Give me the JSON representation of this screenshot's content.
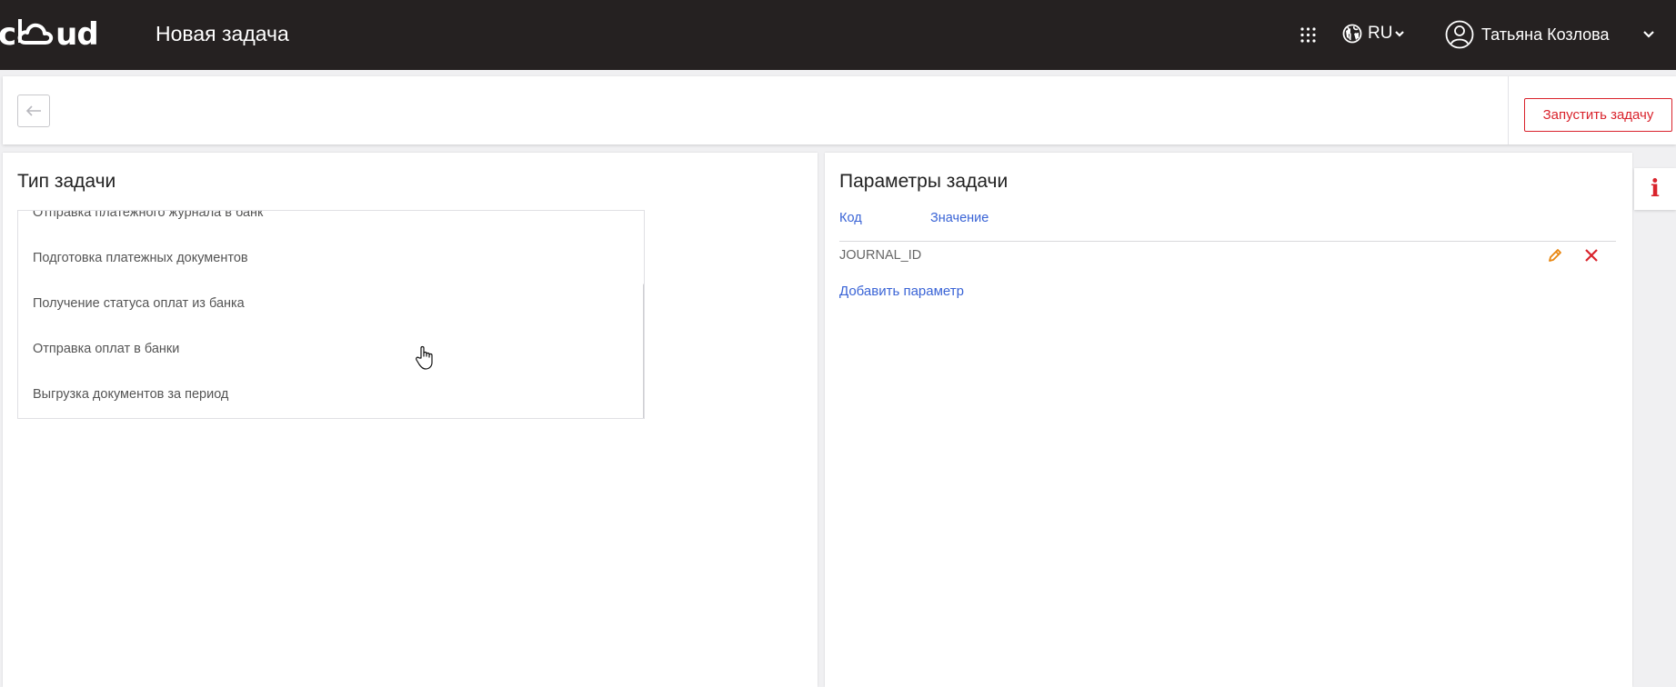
{
  "header": {
    "logo_left": "c",
    "logo_right": "ud",
    "title": "Новая задача",
    "language": "RU",
    "user_name": "Татьяна Козлова"
  },
  "toolbar": {
    "run_label": "Запустить задачу"
  },
  "task_type": {
    "title": "Тип задачи",
    "items": [
      "Отправка платежного журнала в банк",
      "Подготовка платежных документов",
      "Получение статуса оплат из банка",
      "Отправка оплат в банки",
      "Выгрузка документов за период"
    ]
  },
  "task_params": {
    "title": "Параметры задачи",
    "columns": [
      "Код",
      "Значение"
    ],
    "rows": [
      {
        "code": "JOURNAL_ID",
        "value": ""
      }
    ],
    "add_label": "Добавить параметр"
  },
  "colors": {
    "topbar": "#252121",
    "accent_red": "#d9232c",
    "link_blue": "#3a64d6",
    "edit_orange": "#e8860f"
  },
  "icons": {
    "apps": "apps-grid-icon",
    "language": "globe-icon",
    "user": "user-circle-icon",
    "back": "arrow-left-icon",
    "edit": "pencil-icon",
    "delete": "close-icon",
    "info": "info-icon"
  }
}
